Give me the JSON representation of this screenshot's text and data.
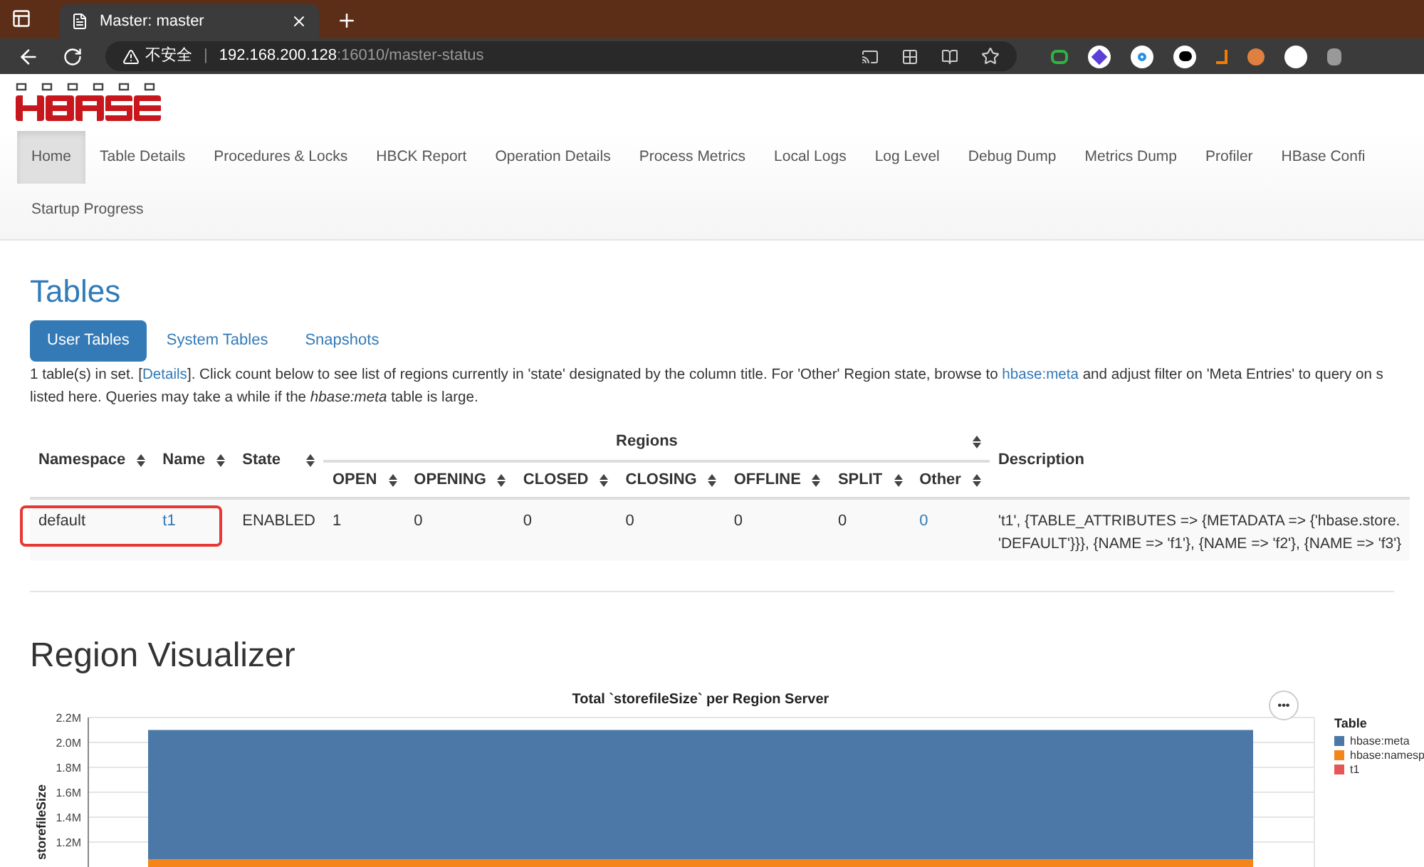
{
  "browser": {
    "tab_title": "Master: master",
    "security": "不安全",
    "separator": "|",
    "host": "192.168.200.128",
    "path": ":16010/master-status"
  },
  "nav": {
    "rows": [
      [
        {
          "label": "Home",
          "selected": true
        },
        {
          "label": "Table Details",
          "selected": false
        },
        {
          "label": "Procedures & Locks",
          "selected": false
        },
        {
          "label": "HBCK Report",
          "selected": false
        },
        {
          "label": "Operation Details",
          "selected": false
        },
        {
          "label": "Process Metrics",
          "selected": false
        },
        {
          "label": "Local Logs",
          "selected": false
        },
        {
          "label": "Log Level",
          "selected": false
        },
        {
          "label": "Debug Dump",
          "selected": false
        },
        {
          "label": "Metrics Dump",
          "selected": false
        },
        {
          "label": "Profiler",
          "selected": false
        },
        {
          "label": "HBase Confi",
          "selected": false
        }
      ],
      [
        {
          "label": "Startup Progress",
          "selected": false
        }
      ]
    ]
  },
  "tables_section": {
    "title": "Tables",
    "tabs": [
      {
        "label": "User Tables",
        "selected": true
      },
      {
        "label": "System Tables",
        "selected": false
      },
      {
        "label": "Snapshots",
        "selected": false
      }
    ],
    "info": {
      "before": "1 table(s) in set. [",
      "link1": "Details",
      "middle": "]. Click count below to see list of regions currently in 'state' designated by the column title. For 'Other' Region state, browse to ",
      "link2": "hbase:meta",
      "after": " and adjust filter on 'Meta Entries' to query on s",
      "line2": "listed here. Queries may take a while if the *hbase:meta* table is large."
    },
    "table": {
      "columns": [
        "Namespace",
        "Name",
        "State"
      ],
      "group": "Regions",
      "sub_columns": [
        "OPEN",
        "OPENING",
        "CLOSED",
        "CLOSING",
        "OFFLINE",
        "SPLIT",
        "Other"
      ],
      "last_column": "Description",
      "rows": [
        {
          "namespace": "default",
          "name": "t1",
          "state": "ENABLED",
          "counts": [
            "1",
            "0",
            "0",
            "0",
            "0",
            "0",
            "0"
          ],
          "description": [
            "'t1', {TABLE_ATTRIBUTES => {METADATA => {'hbase.store.",
            "'DEFAULT'}}}, {NAME => 'f1'}, {NAME => 'f2'}, {NAME => 'f3'}"
          ],
          "highlighted": true
        }
      ]
    }
  },
  "visualizer": {
    "title": "Region Visualizer",
    "menu": "•••",
    "chart_data": {
      "type": "bar",
      "title": "Total `storefileSize` per Region Server",
      "ylabel": "storefileSize",
      "stacked": true,
      "grid": true,
      "categories": [
        null
      ],
      "ylim": [
        0.97,
        2.2
      ],
      "yticks": [
        {
          "value": 1.2,
          "label": "1.2M"
        },
        {
          "value": 1.4,
          "label": "1.4M"
        },
        {
          "value": 1.6,
          "label": "1.6M"
        },
        {
          "value": 1.8,
          "label": "1.8M"
        },
        {
          "value": 2.0,
          "label": "2.0M"
        },
        {
          "value": 2.2,
          "label": "2.2M"
        }
      ],
      "legend": {
        "title": "Table"
      },
      "series": [
        {
          "name": "hbase:namesp",
          "color": "#f58518",
          "values": [
            1.06
          ]
        },
        {
          "name": "hbase:meta",
          "color": "#4c78a8",
          "values": [
            1.04
          ]
        },
        {
          "name": "t1",
          "color": "#e45756",
          "values": [
            null
          ]
        }
      ]
    }
  }
}
